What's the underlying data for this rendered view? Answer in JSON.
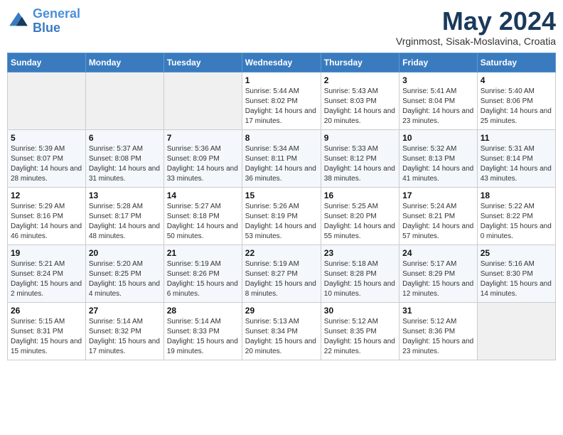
{
  "header": {
    "logo_line1": "General",
    "logo_line2": "Blue",
    "month_title": "May 2024",
    "subtitle": "Vrginmost, Sisak-Moslavina, Croatia"
  },
  "weekdays": [
    "Sunday",
    "Monday",
    "Tuesday",
    "Wednesday",
    "Thursday",
    "Friday",
    "Saturday"
  ],
  "weeks": [
    [
      {
        "day": "",
        "sunrise": "",
        "sunset": "",
        "daylight": ""
      },
      {
        "day": "",
        "sunrise": "",
        "sunset": "",
        "daylight": ""
      },
      {
        "day": "",
        "sunrise": "",
        "sunset": "",
        "daylight": ""
      },
      {
        "day": "1",
        "sunrise": "Sunrise: 5:44 AM",
        "sunset": "Sunset: 8:02 PM",
        "daylight": "Daylight: 14 hours and 17 minutes."
      },
      {
        "day": "2",
        "sunrise": "Sunrise: 5:43 AM",
        "sunset": "Sunset: 8:03 PM",
        "daylight": "Daylight: 14 hours and 20 minutes."
      },
      {
        "day": "3",
        "sunrise": "Sunrise: 5:41 AM",
        "sunset": "Sunset: 8:04 PM",
        "daylight": "Daylight: 14 hours and 23 minutes."
      },
      {
        "day": "4",
        "sunrise": "Sunrise: 5:40 AM",
        "sunset": "Sunset: 8:06 PM",
        "daylight": "Daylight: 14 hours and 25 minutes."
      }
    ],
    [
      {
        "day": "5",
        "sunrise": "Sunrise: 5:39 AM",
        "sunset": "Sunset: 8:07 PM",
        "daylight": "Daylight: 14 hours and 28 minutes."
      },
      {
        "day": "6",
        "sunrise": "Sunrise: 5:37 AM",
        "sunset": "Sunset: 8:08 PM",
        "daylight": "Daylight: 14 hours and 31 minutes."
      },
      {
        "day": "7",
        "sunrise": "Sunrise: 5:36 AM",
        "sunset": "Sunset: 8:09 PM",
        "daylight": "Daylight: 14 hours and 33 minutes."
      },
      {
        "day": "8",
        "sunrise": "Sunrise: 5:34 AM",
        "sunset": "Sunset: 8:11 PM",
        "daylight": "Daylight: 14 hours and 36 minutes."
      },
      {
        "day": "9",
        "sunrise": "Sunrise: 5:33 AM",
        "sunset": "Sunset: 8:12 PM",
        "daylight": "Daylight: 14 hours and 38 minutes."
      },
      {
        "day": "10",
        "sunrise": "Sunrise: 5:32 AM",
        "sunset": "Sunset: 8:13 PM",
        "daylight": "Daylight: 14 hours and 41 minutes."
      },
      {
        "day": "11",
        "sunrise": "Sunrise: 5:31 AM",
        "sunset": "Sunset: 8:14 PM",
        "daylight": "Daylight: 14 hours and 43 minutes."
      }
    ],
    [
      {
        "day": "12",
        "sunrise": "Sunrise: 5:29 AM",
        "sunset": "Sunset: 8:16 PM",
        "daylight": "Daylight: 14 hours and 46 minutes."
      },
      {
        "day": "13",
        "sunrise": "Sunrise: 5:28 AM",
        "sunset": "Sunset: 8:17 PM",
        "daylight": "Daylight: 14 hours and 48 minutes."
      },
      {
        "day": "14",
        "sunrise": "Sunrise: 5:27 AM",
        "sunset": "Sunset: 8:18 PM",
        "daylight": "Daylight: 14 hours and 50 minutes."
      },
      {
        "day": "15",
        "sunrise": "Sunrise: 5:26 AM",
        "sunset": "Sunset: 8:19 PM",
        "daylight": "Daylight: 14 hours and 53 minutes."
      },
      {
        "day": "16",
        "sunrise": "Sunrise: 5:25 AM",
        "sunset": "Sunset: 8:20 PM",
        "daylight": "Daylight: 14 hours and 55 minutes."
      },
      {
        "day": "17",
        "sunrise": "Sunrise: 5:24 AM",
        "sunset": "Sunset: 8:21 PM",
        "daylight": "Daylight: 14 hours and 57 minutes."
      },
      {
        "day": "18",
        "sunrise": "Sunrise: 5:22 AM",
        "sunset": "Sunset: 8:22 PM",
        "daylight": "Daylight: 15 hours and 0 minutes."
      }
    ],
    [
      {
        "day": "19",
        "sunrise": "Sunrise: 5:21 AM",
        "sunset": "Sunset: 8:24 PM",
        "daylight": "Daylight: 15 hours and 2 minutes."
      },
      {
        "day": "20",
        "sunrise": "Sunrise: 5:20 AM",
        "sunset": "Sunset: 8:25 PM",
        "daylight": "Daylight: 15 hours and 4 minutes."
      },
      {
        "day": "21",
        "sunrise": "Sunrise: 5:19 AM",
        "sunset": "Sunset: 8:26 PM",
        "daylight": "Daylight: 15 hours and 6 minutes."
      },
      {
        "day": "22",
        "sunrise": "Sunrise: 5:19 AM",
        "sunset": "Sunset: 8:27 PM",
        "daylight": "Daylight: 15 hours and 8 minutes."
      },
      {
        "day": "23",
        "sunrise": "Sunrise: 5:18 AM",
        "sunset": "Sunset: 8:28 PM",
        "daylight": "Daylight: 15 hours and 10 minutes."
      },
      {
        "day": "24",
        "sunrise": "Sunrise: 5:17 AM",
        "sunset": "Sunset: 8:29 PM",
        "daylight": "Daylight: 15 hours and 12 minutes."
      },
      {
        "day": "25",
        "sunrise": "Sunrise: 5:16 AM",
        "sunset": "Sunset: 8:30 PM",
        "daylight": "Daylight: 15 hours and 14 minutes."
      }
    ],
    [
      {
        "day": "26",
        "sunrise": "Sunrise: 5:15 AM",
        "sunset": "Sunset: 8:31 PM",
        "daylight": "Daylight: 15 hours and 15 minutes."
      },
      {
        "day": "27",
        "sunrise": "Sunrise: 5:14 AM",
        "sunset": "Sunset: 8:32 PM",
        "daylight": "Daylight: 15 hours and 17 minutes."
      },
      {
        "day": "28",
        "sunrise": "Sunrise: 5:14 AM",
        "sunset": "Sunset: 8:33 PM",
        "daylight": "Daylight: 15 hours and 19 minutes."
      },
      {
        "day": "29",
        "sunrise": "Sunrise: 5:13 AM",
        "sunset": "Sunset: 8:34 PM",
        "daylight": "Daylight: 15 hours and 20 minutes."
      },
      {
        "day": "30",
        "sunrise": "Sunrise: 5:12 AM",
        "sunset": "Sunset: 8:35 PM",
        "daylight": "Daylight: 15 hours and 22 minutes."
      },
      {
        "day": "31",
        "sunrise": "Sunrise: 5:12 AM",
        "sunset": "Sunset: 8:36 PM",
        "daylight": "Daylight: 15 hours and 23 minutes."
      },
      {
        "day": "",
        "sunrise": "",
        "sunset": "",
        "daylight": ""
      }
    ]
  ]
}
